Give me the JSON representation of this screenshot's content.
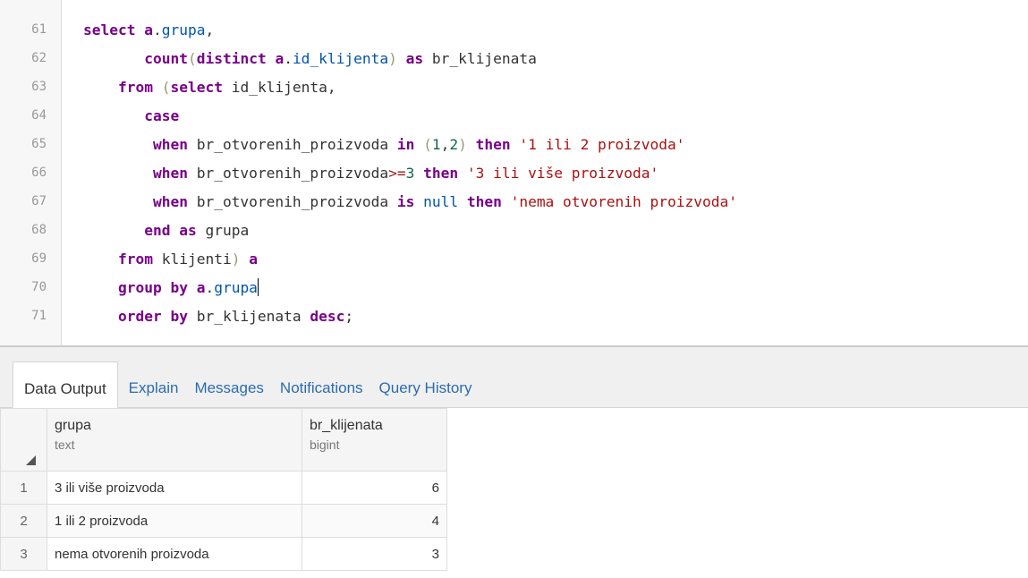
{
  "editor": {
    "lines": [
      {
        "num": "61",
        "segments": [
          {
            "t": "select ",
            "c": "kw"
          },
          {
            "t": "a",
            "c": "kw"
          },
          {
            "t": ".",
            "c": ""
          },
          {
            "t": "grupa",
            "c": "var"
          },
          {
            "t": ",",
            "c": ""
          }
        ]
      },
      {
        "num": "62",
        "segments": [
          {
            "t": "       ",
            "c": ""
          },
          {
            "t": "count",
            "c": "kw"
          },
          {
            "t": "(",
            "c": "paren"
          },
          {
            "t": "distinct ",
            "c": "kw"
          },
          {
            "t": "a",
            "c": "kw"
          },
          {
            "t": ".",
            "c": ""
          },
          {
            "t": "id_klijenta",
            "c": "var"
          },
          {
            "t": ") ",
            "c": "paren"
          },
          {
            "t": "as ",
            "c": "kw"
          },
          {
            "t": "br_klijenata",
            "c": ""
          }
        ]
      },
      {
        "num": "63",
        "segments": [
          {
            "t": "    ",
            "c": ""
          },
          {
            "t": "from ",
            "c": "kw"
          },
          {
            "t": "(",
            "c": "paren"
          },
          {
            "t": "select ",
            "c": "kw"
          },
          {
            "t": "id_klijenta,",
            "c": ""
          }
        ]
      },
      {
        "num": "64",
        "segments": [
          {
            "t": "       ",
            "c": ""
          },
          {
            "t": "case",
            "c": "kw"
          }
        ]
      },
      {
        "num": "65",
        "segments": [
          {
            "t": "        ",
            "c": ""
          },
          {
            "t": "when ",
            "c": "kw"
          },
          {
            "t": "br_otvorenih_proizvoda ",
            "c": ""
          },
          {
            "t": "in ",
            "c": "kw"
          },
          {
            "t": "(",
            "c": "paren"
          },
          {
            "t": "1",
            "c": "num"
          },
          {
            "t": ",",
            "c": ""
          },
          {
            "t": "2",
            "c": "num"
          },
          {
            "t": ") ",
            "c": "paren"
          },
          {
            "t": "then ",
            "c": "kw"
          },
          {
            "t": "'1 ili 2 proizvoda'",
            "c": "str"
          }
        ]
      },
      {
        "num": "66",
        "segments": [
          {
            "t": "        ",
            "c": ""
          },
          {
            "t": "when ",
            "c": "kw"
          },
          {
            "t": "br_otvorenih_proizvoda",
            "c": ""
          },
          {
            "t": ">=",
            "c": "op"
          },
          {
            "t": "3 ",
            "c": "num"
          },
          {
            "t": "then ",
            "c": "kw"
          },
          {
            "t": "'3 ili više proizvoda'",
            "c": "str"
          }
        ]
      },
      {
        "num": "67",
        "segments": [
          {
            "t": "        ",
            "c": ""
          },
          {
            "t": "when ",
            "c": "kw"
          },
          {
            "t": "br_otvorenih_proizvoda ",
            "c": ""
          },
          {
            "t": "is ",
            "c": "kw"
          },
          {
            "t": "null ",
            "c": "var"
          },
          {
            "t": "then ",
            "c": "kw"
          },
          {
            "t": "'nema otvorenih proizvoda'",
            "c": "str"
          }
        ]
      },
      {
        "num": "68",
        "segments": [
          {
            "t": "       ",
            "c": ""
          },
          {
            "t": "end ",
            "c": "kw"
          },
          {
            "t": "as ",
            "c": "kw"
          },
          {
            "t": "grupa",
            "c": ""
          }
        ]
      },
      {
        "num": "69",
        "segments": [
          {
            "t": "    ",
            "c": ""
          },
          {
            "t": "from ",
            "c": "kw"
          },
          {
            "t": "klijenti",
            "c": ""
          },
          {
            "t": ") ",
            "c": "paren"
          },
          {
            "t": "a",
            "c": "kw"
          }
        ]
      },
      {
        "num": "70",
        "segments": [
          {
            "t": "    ",
            "c": ""
          },
          {
            "t": "group by ",
            "c": "kw"
          },
          {
            "t": "a",
            "c": "kw"
          },
          {
            "t": ".",
            "c": ""
          },
          {
            "t": "grupa",
            "c": "var"
          }
        ],
        "cursor": true
      },
      {
        "num": "71",
        "segments": [
          {
            "t": "    ",
            "c": ""
          },
          {
            "t": "order by ",
            "c": "kw"
          },
          {
            "t": "br_klijenata ",
            "c": ""
          },
          {
            "t": "desc",
            "c": "kw"
          },
          {
            "t": ";",
            "c": ""
          }
        ]
      }
    ]
  },
  "tabs": [
    {
      "label": "Data Output",
      "active": true
    },
    {
      "label": "Explain",
      "active": false
    },
    {
      "label": "Messages",
      "active": false
    },
    {
      "label": "Notifications",
      "active": false
    },
    {
      "label": "Query History",
      "active": false
    }
  ],
  "grid": {
    "columns": [
      {
        "name": "grupa",
        "type": "text"
      },
      {
        "name": "br_klijenata",
        "type": "bigint"
      }
    ],
    "rows": [
      {
        "n": "1",
        "grupa": "3 ili više proizvoda",
        "br": "6"
      },
      {
        "n": "2",
        "grupa": "1 ili 2 proizvoda",
        "br": "4"
      },
      {
        "n": "3",
        "grupa": "nema otvorenih proizvoda",
        "br": "3"
      }
    ]
  }
}
